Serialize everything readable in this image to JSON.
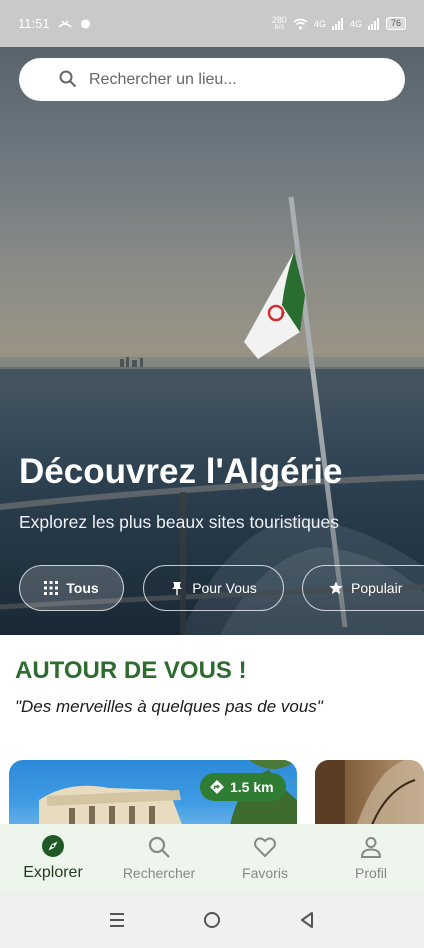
{
  "status_bar": {
    "time": "11:51",
    "data_speed": "280",
    "data_unit": "B/S",
    "network_1": "4G",
    "network_2": "4G",
    "battery": "76"
  },
  "search": {
    "placeholder": "Rechercher un lieu..."
  },
  "hero": {
    "title": "Découvrez l'Algérie",
    "subtitle": "Explorez les plus beaux sites touristiques"
  },
  "filters": [
    {
      "label": "Tous",
      "icon": "grid-icon",
      "active": true
    },
    {
      "label": "Pour Vous",
      "icon": "pin-icon",
      "active": false
    },
    {
      "label": "Populair",
      "icon": "star-icon",
      "active": false
    }
  ],
  "section": {
    "title": "AUTOUR DE VOUS !",
    "subtitle": "\"Des merveilles à quelques pas de vous\""
  },
  "cards": [
    {
      "distance": "1.5 km",
      "icon": "directions-icon"
    }
  ],
  "bottom_nav": [
    {
      "label": "Explorer",
      "icon": "compass-icon",
      "active": true
    },
    {
      "label": "Rechercher",
      "icon": "search-icon",
      "active": false
    },
    {
      "label": "Favoris",
      "icon": "heart-icon",
      "active": false
    },
    {
      "label": "Profil",
      "icon": "person-icon",
      "active": false
    }
  ],
  "colors": {
    "accent_green": "#2e6b2f",
    "badge_green": "#2e7d32",
    "nav_background": "#eef5ec"
  }
}
